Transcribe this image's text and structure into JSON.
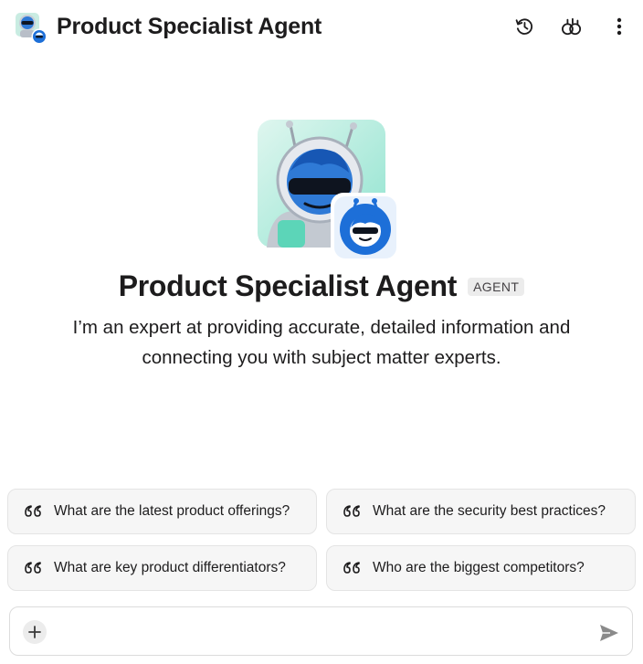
{
  "header": {
    "title": "Product Specialist Agent",
    "avatar_icon": "robot-avatar-icon",
    "actions": [
      "history-icon",
      "new-chat-icon",
      "more-options-icon"
    ]
  },
  "hero": {
    "agent_name": "Product Specialist Agent",
    "badge": "AGENT",
    "description_line1": "I’m an expert at providing accurate, detailed information and",
    "description_line2": "connecting you with subject matter experts."
  },
  "suggestions": [
    {
      "label": "What are the latest product offerings?",
      "icon": "quote-icon"
    },
    {
      "label": "What are the security best practices?",
      "icon": "quote-icon"
    },
    {
      "label": "What are key product differentiators?",
      "icon": "quote-icon"
    },
    {
      "label": "Who are the biggest competitors?",
      "icon": "quote-icon"
    }
  ],
  "composer": {
    "value": "",
    "placeholder": "",
    "add_icon": "plus-icon",
    "send_icon": "send-icon"
  },
  "colors": {
    "accent_blue": "#1d6fd8",
    "mint": "#8fe3cf",
    "card_bg": "#f6f6f6",
    "text": "#1d1c1d"
  }
}
